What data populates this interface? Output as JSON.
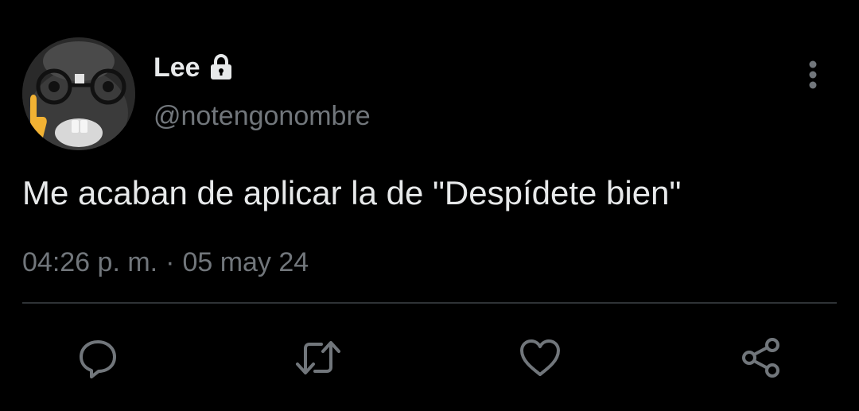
{
  "user": {
    "display_name": "Lee",
    "handle": "@notengonombre",
    "protected_icon": "lock-icon"
  },
  "tweet": {
    "text": "Me acaban de aplicar la de \"Despídete bien\"",
    "time": "04:26 p. m.",
    "separator": "·",
    "date": "05 may 24"
  },
  "actions": [
    {
      "name": "reply",
      "icon": "comment-icon"
    },
    {
      "name": "retweet",
      "icon": "retweet-icon"
    },
    {
      "name": "like",
      "icon": "heart-icon"
    },
    {
      "name": "share",
      "icon": "share-icon"
    }
  ],
  "colors": {
    "background": "#000000",
    "primary_text": "#e7e9ea",
    "secondary_text": "#71767b",
    "divider": "#2f3336",
    "action_icon": "#71767b"
  }
}
